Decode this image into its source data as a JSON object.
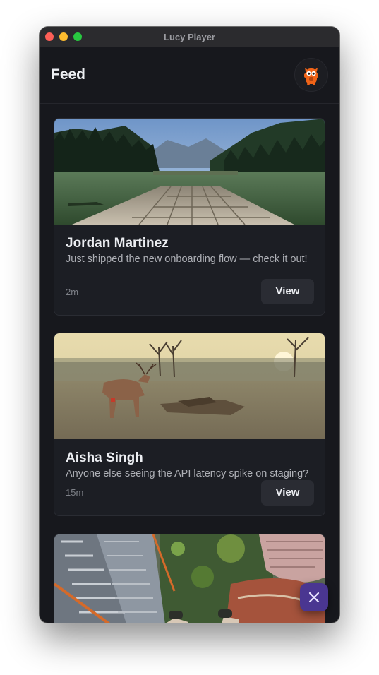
{
  "window": {
    "title": "Lucy Player"
  },
  "header": {
    "title": "Feed",
    "avatar_icon": "orange-mascot-icon"
  },
  "feed": {
    "posts": [
      {
        "author": "Jordan Martinez",
        "text": "Just shipped the new onboarding flow — check it out!",
        "time": "2m",
        "action_label": "View",
        "image_icon": "lake-dock-image"
      },
      {
        "author": "Aisha Singh",
        "text": "Anyone else seeing the API latency spike on staging?",
        "time": "15m",
        "action_label": "View",
        "image_icon": "deer-field-image"
      },
      {
        "image_icon": "city-rooftop-image"
      }
    ]
  },
  "fab": {
    "icon": "close-icon"
  },
  "colors": {
    "background": "#17181d",
    "card": "#1c1e24",
    "accent": "#4a3691",
    "mascot": "#f06418"
  }
}
